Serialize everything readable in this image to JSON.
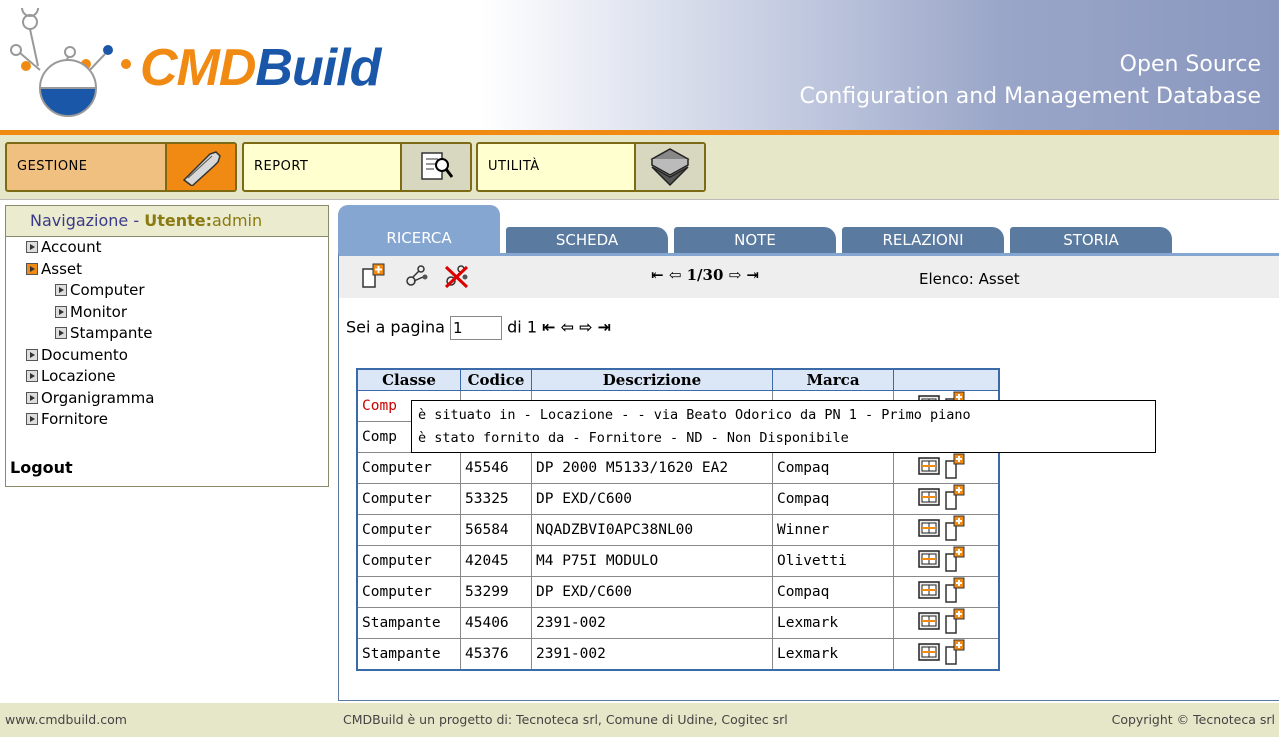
{
  "header": {
    "logo_cmd": "CMD",
    "logo_build": "Build",
    "tagline_1": "Open Source",
    "tagline_2": "Configuration and Management Database"
  },
  "menu": [
    {
      "label": "GESTIONE",
      "icon": "wrench-icon"
    },
    {
      "label": "REPORT",
      "icon": "report-search-icon"
    },
    {
      "label": "UTILITÀ",
      "icon": "stack-icon"
    }
  ],
  "nav": {
    "title_prefix": "Navigazione - ",
    "user_label": "Utente:",
    "user": "admin",
    "items": [
      {
        "label": "Account",
        "level": 1
      },
      {
        "label": "Asset",
        "level": 1,
        "open": true
      },
      {
        "label": "Computer",
        "level": 2
      },
      {
        "label": "Monitor",
        "level": 2
      },
      {
        "label": "Stampante",
        "level": 2
      },
      {
        "label": "Documento",
        "level": 1
      },
      {
        "label": "Locazione",
        "level": 1
      },
      {
        "label": "Organigramma",
        "level": 1
      },
      {
        "label": "Fornitore",
        "level": 1
      }
    ],
    "logout": "Logout"
  },
  "tabs": [
    "RICERCA",
    "SCHEDA",
    "NOTE",
    "RELAZIONI",
    "STORIA"
  ],
  "toolbar": {
    "record_pos": "1/30",
    "elenco": "Elenco: Asset",
    "icons": [
      "new-card-icon",
      "relations-icon",
      "delete-relations-icon"
    ]
  },
  "paging": {
    "label": "Sei a pagina",
    "page_value": "1",
    "of_label": "di 1"
  },
  "table": {
    "columns": [
      "Classe",
      "Codice",
      "Descrizione",
      "Marca",
      ""
    ],
    "rows": [
      {
        "classe": "Comp",
        "codice": "",
        "descrizione": "",
        "marca": "",
        "highlight": true
      },
      {
        "classe": "Comp",
        "codice": "",
        "descrizione": "",
        "marca": ""
      },
      {
        "classe": "Computer",
        "codice": "45546",
        "descrizione": "DP 2000 M5133/1620 EA2",
        "marca": "Compaq"
      },
      {
        "classe": "Computer",
        "codice": "53325",
        "descrizione": "DP EXD/C600",
        "marca": "Compaq"
      },
      {
        "classe": "Computer",
        "codice": "56584",
        "descrizione": "NQADZBVI0APC38NL00",
        "marca": "Winner"
      },
      {
        "classe": "Computer",
        "codice": "42045",
        "descrizione": "M4 P75I MODULO",
        "marca": "Olivetti"
      },
      {
        "classe": "Computer",
        "codice": "53299",
        "descrizione": "DP EXD/C600",
        "marca": "Compaq"
      },
      {
        "classe": "Stampante",
        "codice": "45406",
        "descrizione": "2391-002",
        "marca": "Lexmark"
      },
      {
        "classe": "Stampante",
        "codice": "45376",
        "descrizione": "2391-002",
        "marca": "Lexmark"
      }
    ]
  },
  "tooltip": {
    "line1": "è situato in - Locazione - - via Beato Odorico da PN 1 - Primo piano",
    "line2": "è stato fornito da - Fornitore - ND - Non Disponibile"
  },
  "footer": {
    "site": "www.cmdbuild.com",
    "project": "CMDBuild è un progetto di: Tecnoteca srl, Comune di Udine, Cogitec srl",
    "copyright": "Copyright © Tecnoteca srl"
  }
}
